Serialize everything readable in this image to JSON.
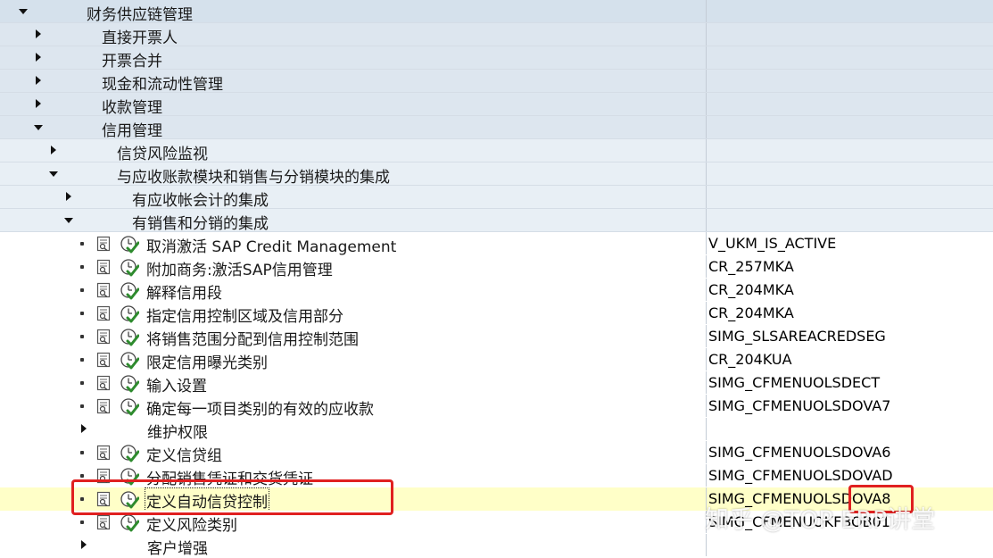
{
  "tree": {
    "rows": [
      {
        "type": "group",
        "level": 0,
        "state": "open",
        "label": "财务供应链管理",
        "tcode": ""
      },
      {
        "type": "group",
        "level": 1,
        "state": "closed",
        "label": "直接开票人",
        "tcode": ""
      },
      {
        "type": "group",
        "level": 1,
        "state": "closed",
        "label": "开票合并",
        "tcode": ""
      },
      {
        "type": "group",
        "level": 1,
        "state": "closed",
        "label": "现金和流动性管理",
        "tcode": ""
      },
      {
        "type": "group",
        "level": 1,
        "state": "closed",
        "label": "收款管理",
        "tcode": ""
      },
      {
        "type": "group",
        "level": 1,
        "state": "open",
        "label": "信用管理",
        "tcode": ""
      },
      {
        "type": "group",
        "level": 2,
        "state": "closed",
        "label": "信贷风险监视",
        "tcode": ""
      },
      {
        "type": "group",
        "level": 2,
        "state": "open",
        "label": "与应收账款模块和销售与分销模块的集成",
        "tcode": ""
      },
      {
        "type": "group",
        "level": 3,
        "state": "closed",
        "label": "有应收帐会计的集成",
        "tcode": ""
      },
      {
        "type": "group",
        "level": 3,
        "state": "open",
        "label": "有销售和分销的集成",
        "tcode": ""
      },
      {
        "type": "activity",
        "label": "取消激活 SAP Credit Management",
        "tcode": "V_UKM_IS_ACTIVE"
      },
      {
        "type": "activity",
        "label": "附加商务:激活SAP信用管理",
        "tcode": "CR_257MKA"
      },
      {
        "type": "activity",
        "label": "解释信用段",
        "tcode": "CR_204MKA"
      },
      {
        "type": "activity",
        "label": "指定信用控制区域及信用部分",
        "tcode": "CR_204MKA"
      },
      {
        "type": "activity",
        "label": "将销售范围分配到信用控制范围",
        "tcode": "SIMG_SLSAREACREDSEG"
      },
      {
        "type": "activity",
        "label": "限定信用曝光类别",
        "tcode": "CR_204KUA"
      },
      {
        "type": "activity",
        "label": "输入设置",
        "tcode": "SIMG_CFMENUOLSDECT"
      },
      {
        "type": "activity",
        "label": "确定每一项目类别的有效的应收款",
        "tcode": "SIMG_CFMENUOLSDOVA7"
      },
      {
        "type": "subfolder",
        "label": "维护权限",
        "tcode": ""
      },
      {
        "type": "activity",
        "label": "定义信贷组",
        "tcode": "SIMG_CFMENUOLSDOVA6"
      },
      {
        "type": "activity",
        "label": "分配销售凭证和交货凭证",
        "tcode": "SIMG_CFMENUOLSDOVAD"
      },
      {
        "type": "activity",
        "label": "定义自动信贷控制",
        "tcode": "SIMG_CFMENUOLSDOVA8",
        "selected": true
      },
      {
        "type": "activity",
        "label": "定义风险类别",
        "tcode": "SIMG_CFMENUOKFBOB01"
      },
      {
        "type": "subfolder",
        "label": "客户增强",
        "tcode": ""
      }
    ]
  },
  "watermark": "知乎 @TOP ERP讲堂",
  "colors": {
    "highlight_box": "#e02020",
    "selected_row": "#ffffc8",
    "group_bg": "#d5e1ec",
    "exec_green": "#2e8b2e"
  },
  "icons": {
    "expand_open": "triangle-down-icon",
    "expand_closed": "triangle-right-icon",
    "documentation": "documentation-icon",
    "execute": "execute-clock-check-icon"
  }
}
